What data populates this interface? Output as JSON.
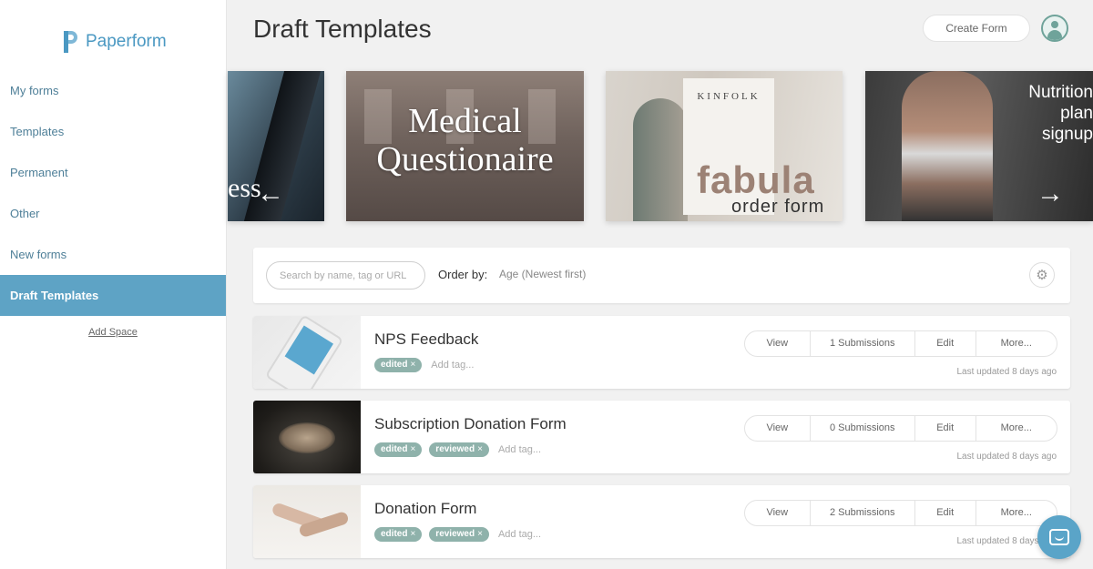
{
  "brand": {
    "name": "Paperform"
  },
  "sidebar": {
    "items": [
      {
        "label": "My forms"
      },
      {
        "label": "Templates"
      },
      {
        "label": "Permanent"
      },
      {
        "label": "Other"
      },
      {
        "label": "New forms"
      },
      {
        "label": "Draft Templates",
        "active": true
      }
    ],
    "add_space": "Add Space"
  },
  "header": {
    "title": "Draft Templates",
    "create_button": "Create Form"
  },
  "carousel": {
    "slides": [
      {
        "text": "ess"
      },
      {
        "text": "Medical Questionaire"
      },
      {
        "book_title": "KINFOLK",
        "title": "fabula",
        "subtitle": "order form"
      },
      {
        "text": "Nutrition plan signup"
      }
    ]
  },
  "toolbar": {
    "search_placeholder": "Search by name, tag or URL",
    "order_label": "Order by:",
    "order_value": "Age (Newest first)"
  },
  "forms": [
    {
      "title": "NPS Feedback",
      "tags": [
        "edited"
      ],
      "add_tag": "Add tag...",
      "view": "View",
      "submissions": "1 Submissions",
      "edit": "Edit",
      "more": "More...",
      "updated": "Last updated 8 days ago"
    },
    {
      "title": "Subscription Donation Form",
      "tags": [
        "edited",
        "reviewed"
      ],
      "add_tag": "Add tag...",
      "view": "View",
      "submissions": "0 Submissions",
      "edit": "Edit",
      "more": "More...",
      "updated": "Last updated 8 days ago"
    },
    {
      "title": "Donation Form",
      "tags": [
        "edited",
        "reviewed"
      ],
      "add_tag": "Add tag...",
      "view": "View",
      "submissions": "2 Submissions",
      "edit": "Edit",
      "more": "More...",
      "updated": "Last updated 8 days ago"
    }
  ],
  "icons": {
    "arrow_left": "←",
    "arrow_right": "→",
    "gear": "⚙",
    "tag_remove": "×"
  },
  "colors": {
    "accent": "#5ea3c5",
    "brand": "#4a98c2",
    "tag": "#8fb2ab"
  }
}
